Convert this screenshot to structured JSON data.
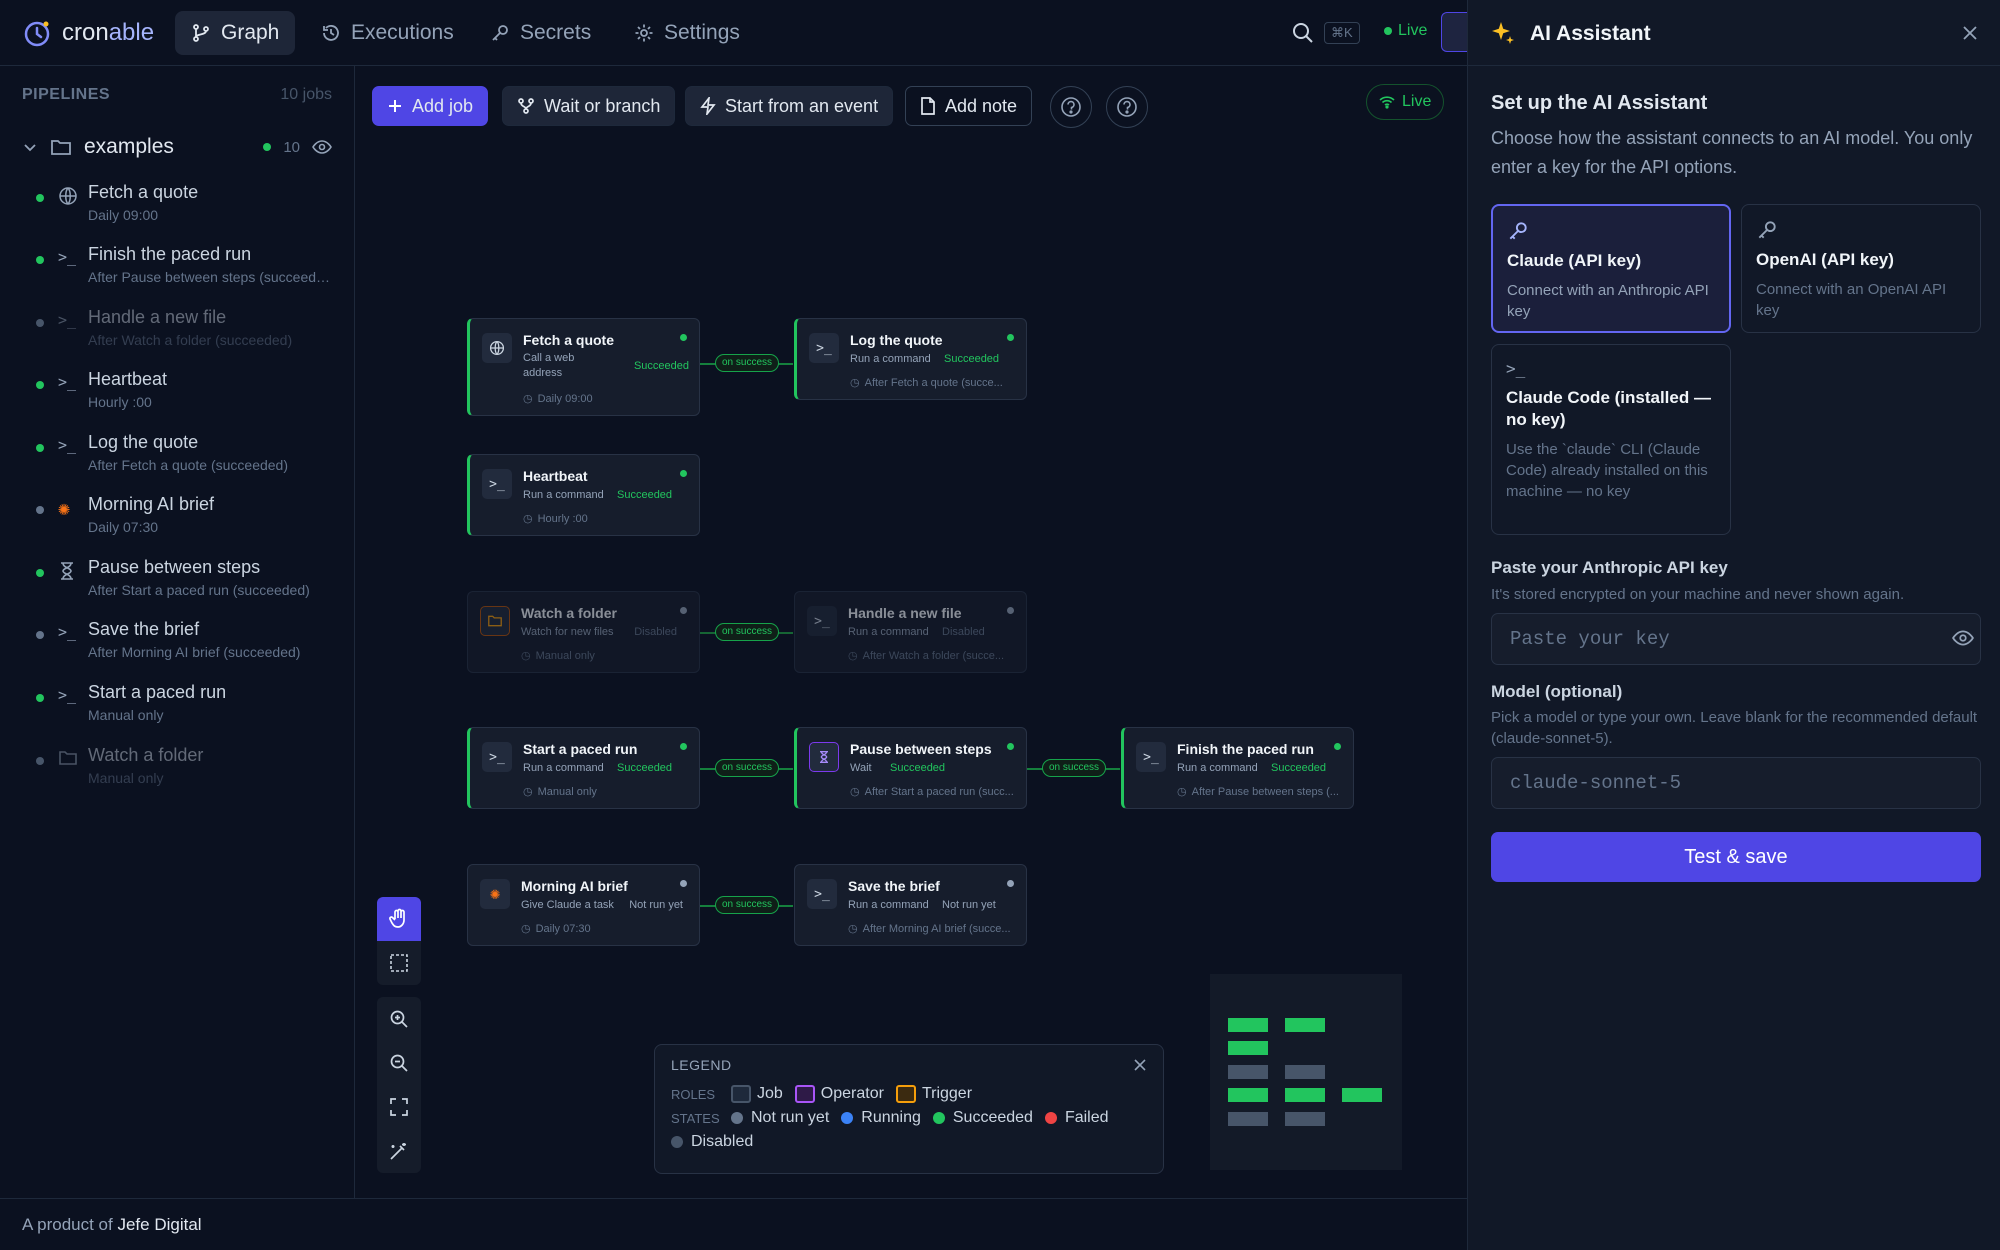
{
  "app": {
    "logo_prefix": "cron",
    "logo_suffix": "able"
  },
  "nav": {
    "tabs": [
      {
        "label": "Graph",
        "icon": "branch-icon"
      },
      {
        "label": "Executions",
        "icon": "history-icon"
      },
      {
        "label": "Secrets",
        "icon": "key-icon"
      },
      {
        "label": "Settings",
        "icon": "gear-icon"
      }
    ],
    "shortcut": "⌘K",
    "live": "Live"
  },
  "sidebar": {
    "title": "PIPELINES",
    "count": "10 jobs",
    "folder": {
      "name": "examples",
      "count": "10"
    },
    "items": [
      {
        "name": "Fetch a quote",
        "sub": "Daily 09:00",
        "icon": "globe-icon",
        "status": "ok"
      },
      {
        "name": "Finish the paced run",
        "sub": "After Pause between steps (succeeded)",
        "icon": "terminal-icon",
        "status": "ok"
      },
      {
        "name": "Handle a new file",
        "sub": "After Watch a folder (succeeded)",
        "icon": "terminal-icon",
        "status": "disabled"
      },
      {
        "name": "Heartbeat",
        "sub": "Hourly :00",
        "icon": "terminal-icon",
        "status": "ok"
      },
      {
        "name": "Log the quote",
        "sub": "After Fetch a quote (succeeded)",
        "icon": "terminal-icon",
        "status": "ok"
      },
      {
        "name": "Morning AI brief",
        "sub": "Daily 07:30",
        "icon": "claude-icon",
        "status": "idle"
      },
      {
        "name": "Pause between steps",
        "sub": "After Start a paced run (succeeded)",
        "icon": "hourglass-icon",
        "status": "ok"
      },
      {
        "name": "Save the brief",
        "sub": "After Morning AI brief (succeeded)",
        "icon": "terminal-icon",
        "status": "idle"
      },
      {
        "name": "Start a paced run",
        "sub": "Manual only",
        "icon": "terminal-icon",
        "status": "ok"
      },
      {
        "name": "Watch a folder",
        "sub": "Manual only",
        "icon": "folder-icon",
        "status": "disabled"
      }
    ]
  },
  "toolbar": {
    "add_job": "Add job",
    "wait_branch": "Wait or branch",
    "start_event": "Start from an event",
    "add_note": "Add note",
    "live": "Live"
  },
  "nodes": {
    "fetch": {
      "title": "Fetch a quote",
      "sub1": "Call a web",
      "sub2": "address",
      "state": "Succeeded",
      "schedule": "Daily 09:00"
    },
    "log": {
      "title": "Log the quote",
      "sub": "Run a command",
      "state": "Succeeded",
      "schedule": "After Fetch a quote (succe..."
    },
    "heartbeat": {
      "title": "Heartbeat",
      "sub": "Run a command",
      "state": "Succeeded",
      "schedule": "Hourly :00"
    },
    "watch": {
      "title": "Watch a folder",
      "sub": "Watch for new files",
      "state": "Disabled",
      "schedule": "Manual only"
    },
    "handle": {
      "title": "Handle a new file",
      "sub": "Run a command",
      "state": "Disabled",
      "schedule": "After Watch a folder (succe..."
    },
    "start": {
      "title": "Start a paced run",
      "sub": "Run a command",
      "state": "Succeeded",
      "schedule": "Manual only"
    },
    "pause": {
      "title": "Pause between steps",
      "sub": "Wait",
      "state": "Succeeded",
      "schedule": "After Start a paced run (succ..."
    },
    "finish": {
      "title": "Finish the paced run",
      "sub": "Run a command",
      "state": "Succeeded",
      "schedule": "After Pause between steps (..."
    },
    "morning": {
      "title": "Morning AI brief",
      "sub": "Give Claude a task",
      "state": "Not run yet",
      "schedule": "Daily 07:30"
    },
    "save": {
      "title": "Save the brief",
      "sub": "Run a command",
      "state": "Not run yet",
      "schedule": "After Morning AI brief (succe..."
    }
  },
  "edge_label": "on success",
  "legend": {
    "title": "LEGEND",
    "roles_label": "ROLES",
    "roles": [
      "Job",
      "Operator",
      "Trigger"
    ],
    "states_label": "STATES",
    "states": [
      "Not run yet",
      "Running",
      "Succeeded",
      "Failed",
      "Disabled"
    ],
    "colors": {
      "not_run": "#64748b",
      "running": "#3b82f6",
      "succeeded": "#22c55e",
      "failed": "#ef4444",
      "disabled": "#475569"
    }
  },
  "footer": {
    "prefix": "A product of",
    "brand": "Jefe Digital"
  },
  "assistant": {
    "title": "AI Assistant",
    "heading": "Set up the AI Assistant",
    "description": "Choose how the assistant connects to an AI model. You only enter a key for the API options.",
    "options": [
      {
        "title": "Claude (API key)",
        "desc": "Connect with an Anthropic API key",
        "selected": true
      },
      {
        "title": "OpenAI (API key)",
        "desc": "Connect with an OpenAI API key",
        "selected": false
      },
      {
        "title": "Claude Code (installed — no key)",
        "desc": "Use the `claude` CLI (Claude Code) already installed on this machine — no key",
        "selected": false
      }
    ],
    "key_label": "Paste your Anthropic API key",
    "key_hint": "It's stored encrypted on your machine and never shown again.",
    "key_placeholder": "Paste your key",
    "model_label": "Model (optional)",
    "model_hint": "Pick a model or type your own. Leave blank for the recommended default (claude-sonnet-5).",
    "model_placeholder": "claude-sonnet-5",
    "save_label": "Test & save"
  },
  "colors": {
    "accent": "#4f46e5",
    "success": "#22c55e",
    "background": "#0b1120"
  }
}
